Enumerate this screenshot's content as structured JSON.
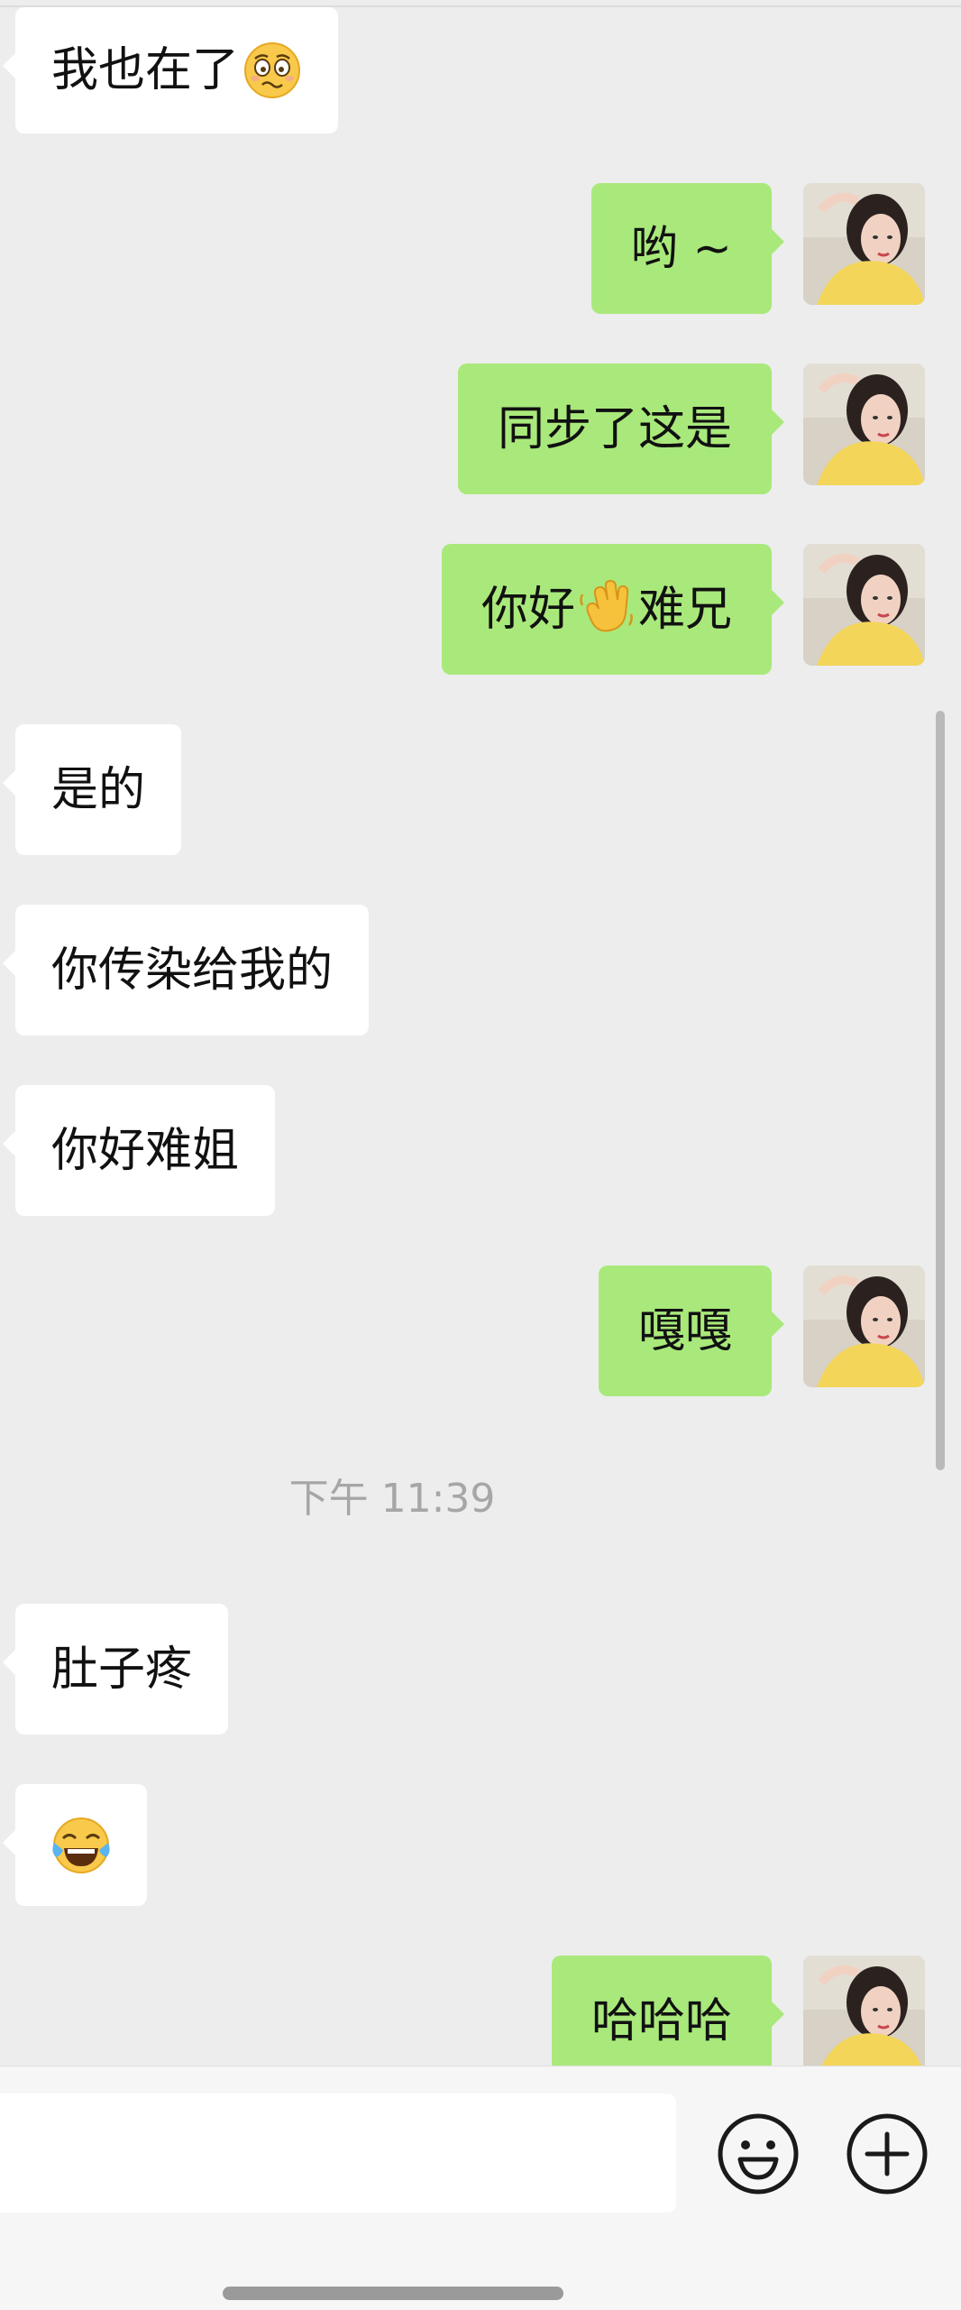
{
  "messages": [
    {
      "side": "in",
      "text": "我也在了",
      "emoji": "woozy-face"
    },
    {
      "side": "out",
      "text": "哟 ~"
    },
    {
      "side": "out",
      "text": "同步了这是"
    },
    {
      "side": "out",
      "text_before": "你好",
      "emoji": "waving-hand",
      "text_after": "难兄"
    },
    {
      "side": "in",
      "text": "是的"
    },
    {
      "side": "in",
      "text": "你传染给我的"
    },
    {
      "side": "in",
      "text": "你好难姐"
    },
    {
      "side": "out",
      "text": "嘎嘎"
    },
    {
      "side": "in",
      "text": "肚子疼"
    },
    {
      "side": "in",
      "emoji": "tears-of-joy"
    },
    {
      "side": "out",
      "text": "哈哈哈"
    }
  ],
  "timestamp": "下午 11:39",
  "input_bar": {
    "emoji_button": "smiley-icon",
    "more_button": "plus-circle-icon"
  },
  "colors": {
    "background": "#ededed",
    "incoming_bubble": "#ffffff",
    "outgoing_bubble": "#a9e97b",
    "timestamp": "#a6a6a6"
  }
}
